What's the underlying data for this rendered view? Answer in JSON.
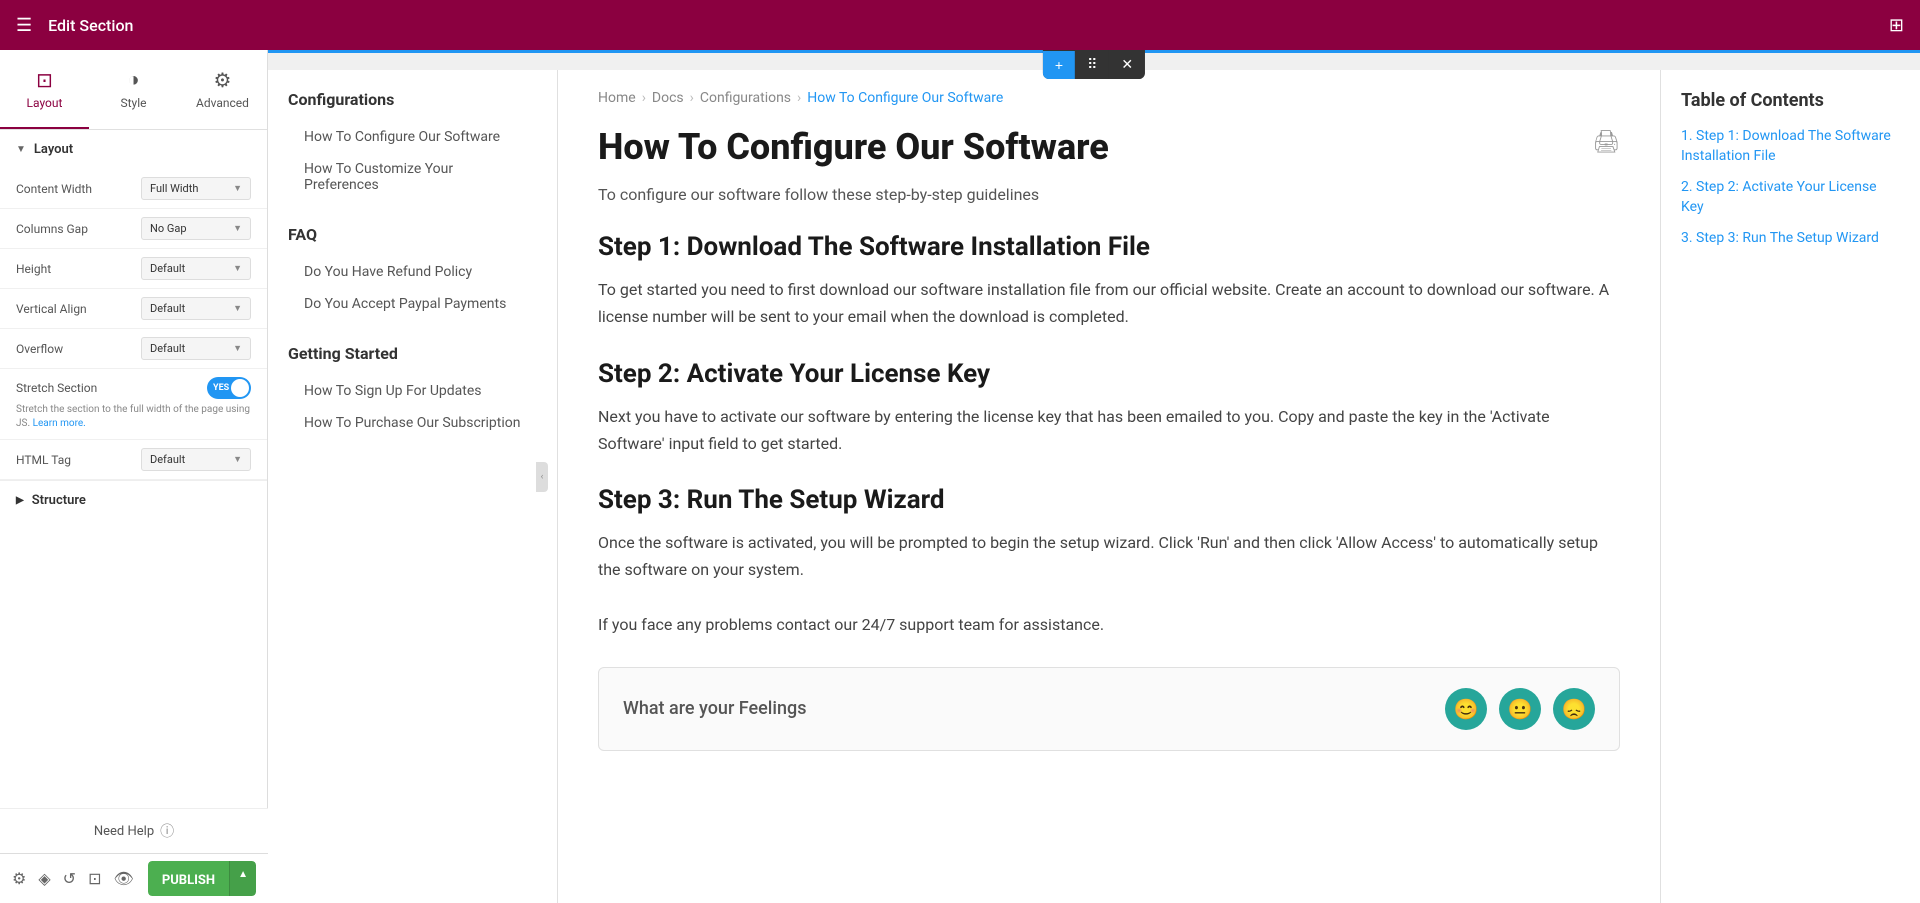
{
  "topbar": {
    "title": "Edit Section",
    "menu_icon": "☰",
    "grid_icon": "⊞"
  },
  "tabs": [
    {
      "id": "layout",
      "label": "Layout",
      "icon": "⊡",
      "active": true
    },
    {
      "id": "style",
      "label": "Style",
      "icon": "◑"
    },
    {
      "id": "advanced",
      "label": "Advanced",
      "icon": "⚙"
    }
  ],
  "panel": {
    "layout_section": {
      "label": "Layout",
      "fields": [
        {
          "label": "Content Width",
          "value": "Full Width"
        },
        {
          "label": "Columns Gap",
          "value": "No Gap"
        },
        {
          "label": "Height",
          "value": "Default"
        },
        {
          "label": "Vertical Align",
          "value": "Default"
        },
        {
          "label": "Overflow",
          "value": "Default"
        },
        {
          "label": "HTML Tag",
          "value": "Default"
        }
      ],
      "stretch": {
        "label": "Stretch Section",
        "toggle_text": "YES",
        "note": "Stretch the section to the full width of the page using JS.",
        "link_text": "Learn more."
      }
    },
    "structure_section": {
      "label": "Structure"
    },
    "need_help": "Need Help",
    "help_icon": "?",
    "bottom_icons": [
      "⚙",
      "◈",
      "↺",
      "⊡",
      "👁"
    ],
    "publish_label": "PUBLISH"
  },
  "floating_toolbar": {
    "plus": "+",
    "move": "⠿",
    "close": "✕"
  },
  "nav": {
    "groups": [
      {
        "title": "Configurations",
        "links": [
          "How To Configure Our Software",
          "How To Customize Your Preferences"
        ]
      },
      {
        "title": "FAQ",
        "links": [
          "Do You Have Refund Policy",
          "Do You Accept Paypal Payments"
        ]
      },
      {
        "title": "Getting Started",
        "links": [
          "How To Sign Up For Updates",
          "How To Purchase Our Subscription"
        ]
      }
    ]
  },
  "breadcrumb": {
    "items": [
      "Home",
      "Docs",
      "Configurations"
    ],
    "active": "How To Configure Our Software",
    "seps": [
      "›",
      "›",
      "›"
    ]
  },
  "article": {
    "title": "How To Configure Our Software",
    "intro": "To configure our software follow these step-by-step guidelines",
    "steps": [
      {
        "title": "Step 1: Download The Software Installation File",
        "body": "To get started you need to first download our software installation file from our official website. Create an account to download our software. A license number will be sent to your email when the download is completed."
      },
      {
        "title": "Step 2: Activate Your License Key",
        "body": "Next you have to activate our software by entering the license key that has been emailed to you. Copy and paste the key in the 'Activate Software' input field to get started."
      },
      {
        "title": "Step 3: Run The Setup Wizard",
        "body": "Once the software is activated, you will be prompted to begin the setup wizard. Click 'Run' and then click 'Allow Access' to automatically setup the software on your system."
      }
    ],
    "support_note": "If you face any problems contact our 24/7 support team for assistance.",
    "feelings_prompt": "What are your Feelings"
  },
  "toc": {
    "title": "Table of Contents",
    "items": [
      "1. Step 1: Download The Software Installation File",
      "2. Step 2: Activate Your License Key",
      "3. Step 3: Run The Setup Wizard"
    ]
  }
}
